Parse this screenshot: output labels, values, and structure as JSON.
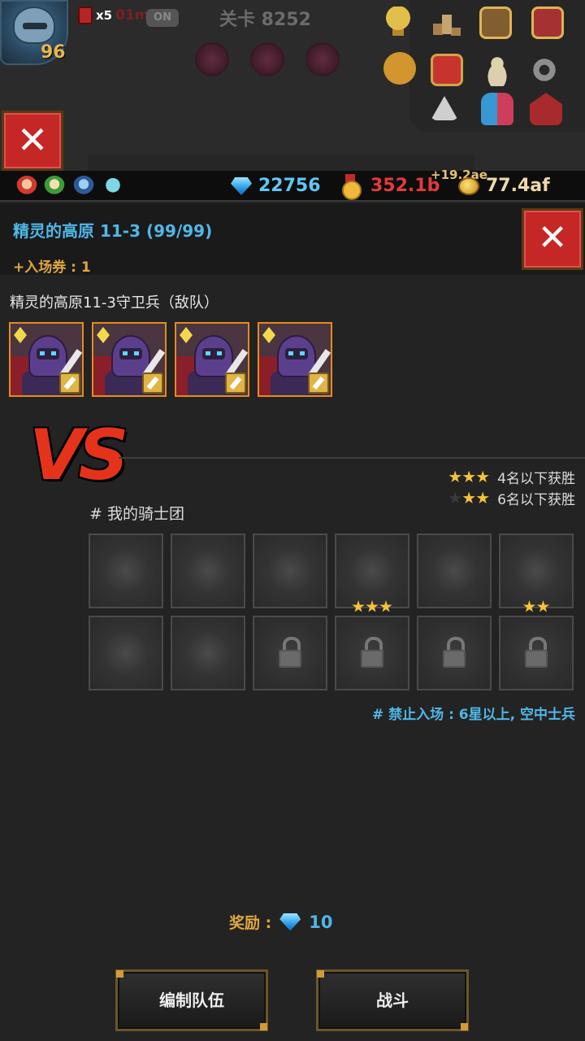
{
  "hud": {
    "player_level": "96",
    "boost_multiplier": "x5",
    "boost_time": "01m",
    "auto_toggle": "ON",
    "stage_label": "关卡 8252",
    "icons": [
      "trophy-icon",
      "ranking-icon",
      "quest-book-icon",
      "spellbook-icon",
      "chat-icon",
      "guild-icon",
      "angel-icon",
      "gear-icon",
      "warning-icon",
      "friends-icon",
      "mailbox-icon"
    ]
  },
  "resources": {
    "gems": "22756",
    "medals": "352.1b",
    "gold_gain": "+19.2ae",
    "gold": "77.4af"
  },
  "stage": {
    "title": "精灵的高原 11-3  (99/99)",
    "ticket": "+入场券 : 1"
  },
  "enemy": {
    "title": "精灵的高原11-3守卫兵（敌队）",
    "count": 4
  },
  "vs_label": "VS",
  "win_conditions": [
    {
      "stars": 3,
      "text": "4名以下获胜"
    },
    {
      "stars": 2,
      "text": "6名以下获胜"
    }
  ],
  "team": {
    "title": "# 我的骑士团",
    "slots": [
      {
        "locked": false,
        "stars": 0
      },
      {
        "locked": false,
        "stars": 0
      },
      {
        "locked": false,
        "stars": 0
      },
      {
        "locked": false,
        "stars": 3
      },
      {
        "locked": false,
        "stars": 0
      },
      {
        "locked": false,
        "stars": 2
      },
      {
        "locked": false,
        "stars": 0
      },
      {
        "locked": false,
        "stars": 0
      },
      {
        "locked": true,
        "stars": 0
      },
      {
        "locked": true,
        "stars": 0
      },
      {
        "locked": true,
        "stars": 0
      },
      {
        "locked": true,
        "stars": 0
      }
    ]
  },
  "ban_note": "# 禁止入场 : 6星以上, 空中士兵",
  "reward": {
    "label": "奖励 :",
    "value": "10"
  },
  "buttons": {
    "edit_team": "编制队伍",
    "battle": "战斗"
  },
  "colors": {
    "accent_blue": "#4fb7e8",
    "accent_gold": "#e0a83c",
    "close_red": "#c52626",
    "enemy_border": "#e48c1b"
  }
}
